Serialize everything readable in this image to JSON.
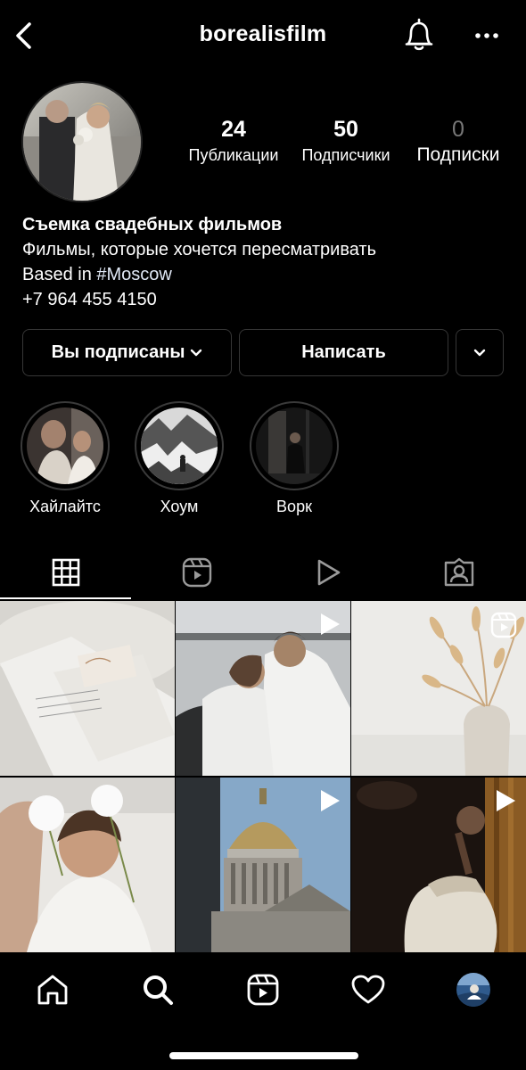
{
  "header": {
    "username": "borealisfilm",
    "back_icon": "chevron-left-icon",
    "notify_icon": "bell-icon",
    "more_icon": "more-horizontal-icon"
  },
  "profile": {
    "stats": [
      {
        "value": "24",
        "label": "Публикации"
      },
      {
        "value": "50",
        "label": "Подписчики"
      },
      {
        "value": "0",
        "label": "Подписки"
      }
    ],
    "bio": {
      "name": "Съемка свадебных фильмов",
      "line1": "Фильмы, которые хочется пересматривать",
      "line2_prefix": "Based in ",
      "line2_tag": "#Moscow",
      "phone": "+7 964 455 4150"
    }
  },
  "actions": {
    "following_label": "Вы подписаны",
    "message_label": "Написать"
  },
  "highlights": [
    {
      "label": "Хайлайтс"
    },
    {
      "label": "Хоум"
    },
    {
      "label": "Ворк"
    }
  ],
  "tabs": [
    {
      "icon": "grid-icon",
      "active": true
    },
    {
      "icon": "reels-icon",
      "active": false
    },
    {
      "icon": "play-icon",
      "active": false
    },
    {
      "icon": "tagged-icon",
      "active": false
    }
  ],
  "grid_badges": [
    "none",
    "play",
    "reels",
    "none",
    "play",
    "play"
  ],
  "bottom_nav": [
    "home-icon",
    "search-icon",
    "reels-icon",
    "heart-icon",
    "profile-avatar"
  ],
  "colors": {
    "background": "#000000",
    "text": "#ffffff",
    "muted": "#777777",
    "border": "#363636",
    "hashtag": "#e0e8f5"
  }
}
